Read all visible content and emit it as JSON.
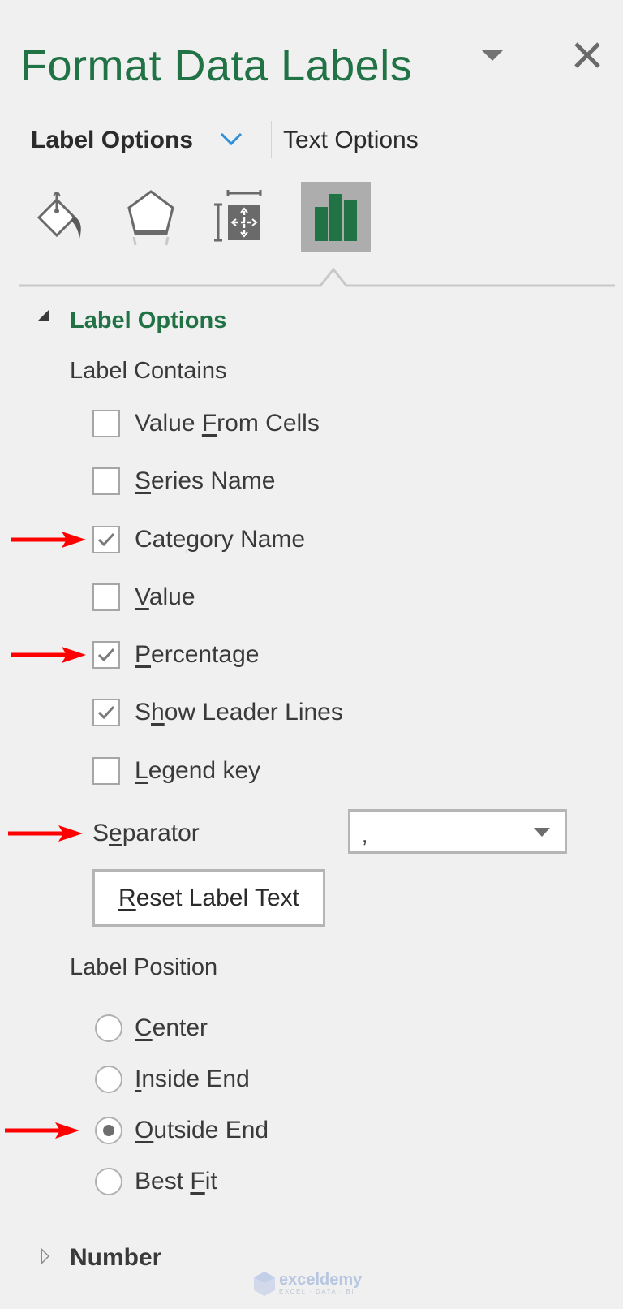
{
  "pane": {
    "title": "Format Data Labels",
    "menu_icon": "dropdown-triangle-icon",
    "close_icon": "close-icon"
  },
  "tabs": {
    "label_options": "Label Options",
    "text_options": "Text Options",
    "active": "Label Options"
  },
  "category_icons": [
    {
      "name": "fill-line-icon",
      "active": false
    },
    {
      "name": "effects-icon",
      "active": false
    },
    {
      "name": "size-properties-icon",
      "active": false
    },
    {
      "name": "label-options-chart-icon",
      "active": true
    }
  ],
  "colors": {
    "accent_green": "#217346",
    "annotation_red": "#ff0000",
    "active_icon_bg": "#adadad"
  },
  "label_options_section": {
    "title": "Label Options",
    "expanded": true,
    "label_contains_heading": "Label Contains",
    "checkboxes": [
      {
        "pre": "Value ",
        "key": "F",
        "post": "rom Cells",
        "checked": false,
        "annotated": false
      },
      {
        "pre": "",
        "key": "S",
        "post": "eries Name",
        "checked": false,
        "annotated": false
      },
      {
        "pre": "Cate",
        "key": "g",
        "post": "ory Name",
        "checked": true,
        "annotated": true
      },
      {
        "pre": "",
        "key": "V",
        "post": "alue",
        "checked": false,
        "annotated": false
      },
      {
        "pre": "",
        "key": "P",
        "post": "ercentage",
        "checked": true,
        "annotated": true
      },
      {
        "pre": "S",
        "key": "h",
        "post": "ow Leader Lines",
        "checked": true,
        "annotated": false
      },
      {
        "pre": "",
        "key": "L",
        "post": "egend key",
        "checked": false,
        "annotated": false
      }
    ],
    "separator": {
      "pre": "S",
      "key": "e",
      "post": "parator",
      "value": ",",
      "annotated": true
    },
    "reset_button": {
      "pre": "",
      "key": "R",
      "post": "eset Label Text"
    },
    "label_position_heading": "Label Position",
    "positions": [
      {
        "pre": "",
        "key": "C",
        "post": "enter",
        "selected": false,
        "annotated": false
      },
      {
        "pre": "",
        "key": "I",
        "post": "nside End",
        "selected": false,
        "annotated": false
      },
      {
        "pre": "",
        "key": "O",
        "post": "utside End",
        "selected": true,
        "annotated": true
      },
      {
        "pre": "Best ",
        "key": "F",
        "post": "it",
        "selected": false,
        "annotated": false
      }
    ]
  },
  "number_section": {
    "title": "Number",
    "expanded": false
  },
  "watermark": {
    "brand": "exceldemy",
    "tagline": "EXCEL · DATA · BI"
  }
}
